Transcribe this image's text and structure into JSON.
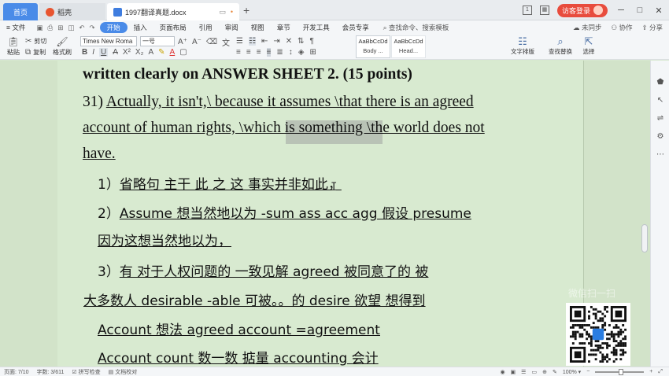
{
  "titlebar": {
    "tabs": [
      {
        "label": "首页"
      },
      {
        "label": "稻壳"
      },
      {
        "label": "1997翻译真题.docx"
      }
    ],
    "new_tab": "+",
    "window_indicator": "1",
    "visitor_login": "访客登录"
  },
  "menubar": {
    "file": "文件",
    "items": [
      "开始",
      "插入",
      "页面布局",
      "引用",
      "审阅",
      "视图",
      "章节",
      "开发工具",
      "会员专享"
    ],
    "active": "开始",
    "search": "查找命令、搜索模板",
    "right": [
      "未同步",
      "协作",
      "分享"
    ]
  },
  "ribbon": {
    "paste": "粘贴",
    "cut": "剪切",
    "copy": "复制",
    "format_painter": "格式刷",
    "font_name": "Times New Roma",
    "font_size": "一号",
    "style1_preview": "AaBbCcDd",
    "style1_label": "Body ...",
    "style2_preview": "AaBbCcDd",
    "style2_label": "Head...",
    "text_layout": "文字排版",
    "find_replace": "查找替换",
    "select": "选择"
  },
  "document": {
    "heading": "written clearly on ANSWER SHEET 2. (15 points)",
    "q_num": "31)",
    "line1": "Actually, it isn't,\\ because it assumes \\that there is an agreed",
    "line2": "account of human rights, \\which is something \\the world does not",
    "line3": "have.",
    "n1": "1）",
    "note1": "省略句  主干    此  之  这    事实并非如此，",
    "n2": "2）",
    "note2": "Assume  想当然地以为  -sum ass acc agg    假设  presume",
    "note2b": "因为这想当然地以为，",
    "n3": "3）",
    "note3": "有   对于人权问题的  一致见解  agreed  被同意了的  被",
    "note3b": "大多数人  desirable    -able  可被。。的    desire  欲望  想得到",
    "note4": "Account  想法      agreed account =agreement",
    "note5": "Account   count   数一数  掂量     accounting  会计",
    "watermark": "微信扫一扫"
  },
  "statusbar": {
    "page": "页面: 7/10",
    "words": "字数: 3/611",
    "spell": "拼写检查",
    "proof": "文档校对",
    "zoom": "100%"
  }
}
